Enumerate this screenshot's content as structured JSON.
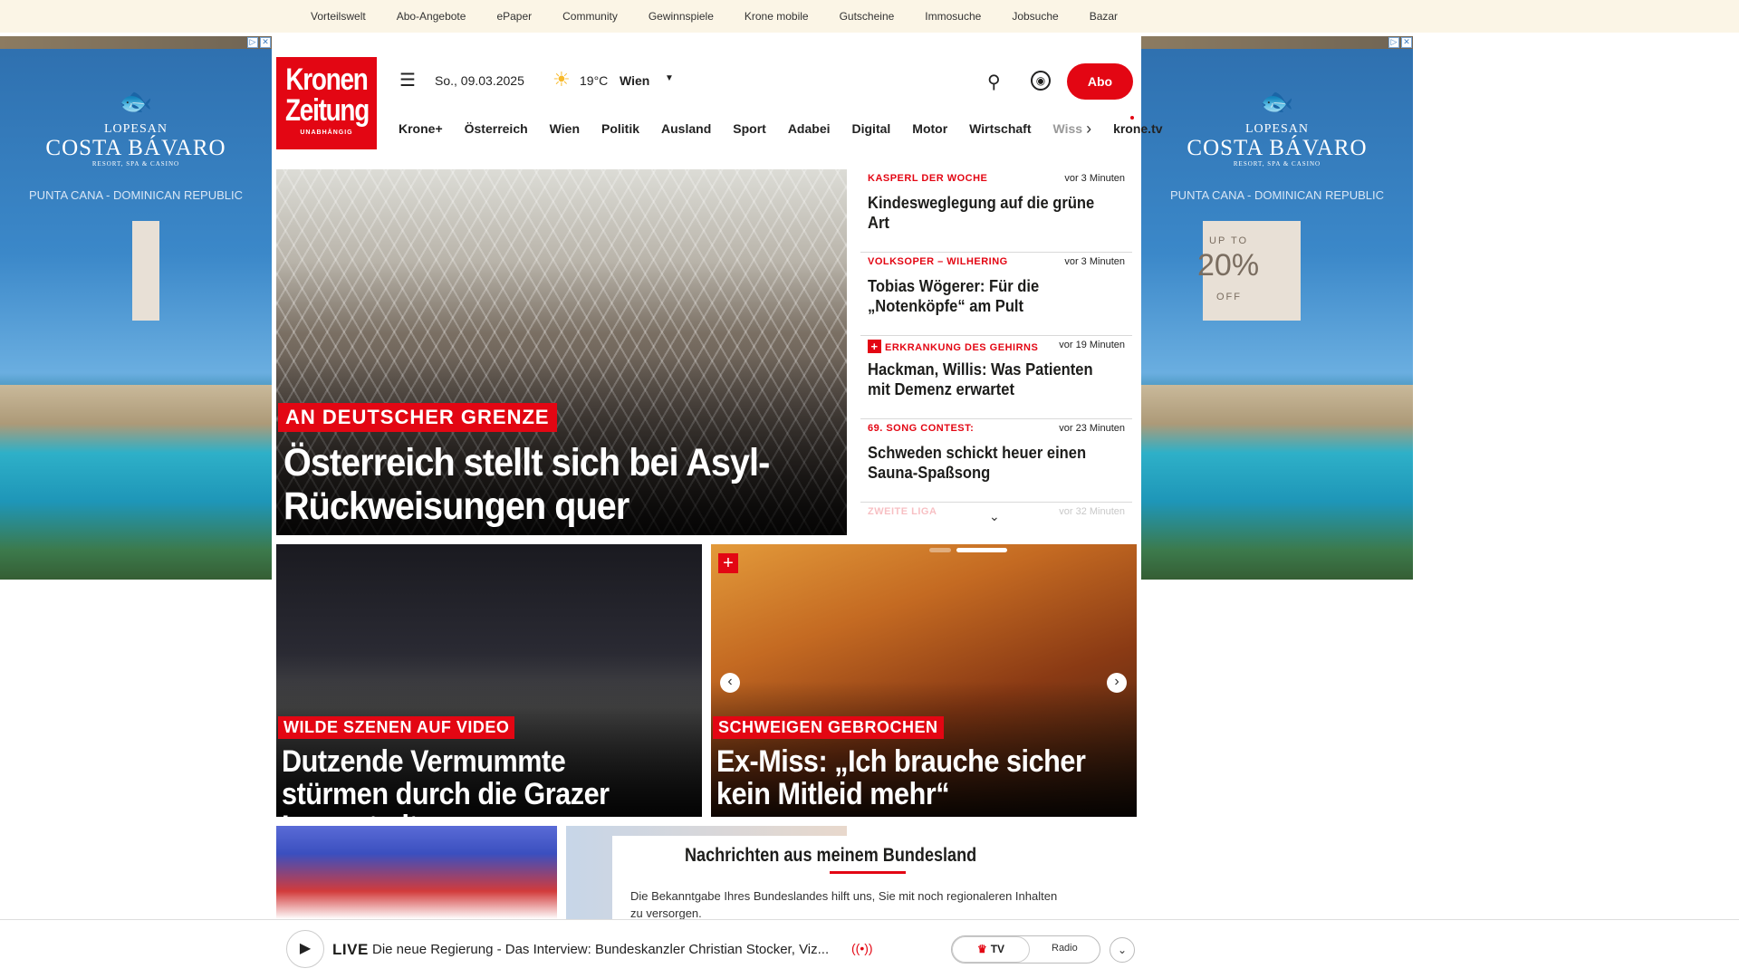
{
  "topbar": {
    "links": [
      "Vorteilswelt",
      "Abo-Angebote",
      "ePaper",
      "Community",
      "Gewinnspiele",
      "Krone mobile",
      "Gutscheine",
      "Immosuche",
      "Jobsuche",
      "Bazar"
    ]
  },
  "ads": {
    "brand_small": "LOPESAN",
    "brand_big": "COSTA BÁVARO",
    "brand_sub": "RESORT, SPA & CASINO",
    "location": "PUNTA CANA - DOMINICAN REPUBLIC",
    "promo_upto": "UP TO",
    "promo_pct": "20%",
    "promo_off": "OFF",
    "close_icons": [
      "ad-info-icon",
      "close-icon"
    ]
  },
  "logo": {
    "line1": "Kronen",
    "line2": "Zeitung",
    "line3": "UNABHÄNGIG"
  },
  "header": {
    "date": "So., 09.03.2025",
    "temperature": "19°C",
    "city": "Wien",
    "abo_label": "Abo",
    "icons": [
      "menu-icon",
      "sun-icon",
      "chevron-down-icon",
      "search-icon",
      "user-icon"
    ]
  },
  "nav": {
    "items": [
      "Krone+",
      "Österreich",
      "Wien",
      "Politik",
      "Ausland",
      "Sport",
      "Adabei",
      "Digital",
      "Motor",
      "Wirtschaft"
    ],
    "truncated": "Wiss",
    "extra": "krone.tv"
  },
  "hero": {
    "kicker": "AN DEUTSCHER GRENZE",
    "title": "Österreich stellt sich bei Asyl-Rückweisungen quer"
  },
  "sidebar": {
    "items": [
      {
        "kicker": "KASPERL DER WOCHE",
        "time": "vor 3 Minuten",
        "headline": "Kindesweglegung auf die grüne Art",
        "plus": false
      },
      {
        "kicker": "VOLKSOPER – WILHERING",
        "time": "vor 3 Minuten",
        "headline": "Tobias Wögerer: Für die „Notenköpfe“ am Pult",
        "plus": false
      },
      {
        "kicker": "ERKRANKUNG DES GEHIRNS",
        "time": "vor 19 Minuten",
        "headline": "Hackman, Willis: Was Patienten mit Demenz erwartet",
        "plus": true
      },
      {
        "kicker": "69. SONG CONTEST:",
        "time": "vor 23 Minuten",
        "headline": "Schweden schickt heuer einen Sauna-Spaßsong",
        "plus": false
      },
      {
        "kicker": "ZWEITE LIGA",
        "time": "vor 32 Minuten",
        "headline": "",
        "plus": false
      }
    ]
  },
  "tiles": [
    {
      "kicker": "WILDE SZENEN AUF VIDEO",
      "title": "Dutzende Vermummte stürmen durch die Grazer Innenstadt"
    },
    {
      "kicker": "SCHWEIGEN GEBROCHEN",
      "title": "Ex-Miss: „Ich brauche sicher kein Mitleid mehr“"
    }
  ],
  "bundesland": {
    "heading": "Nachrichten aus meinem Bundesland",
    "text": "Die Bekanntgabe Ihres Bundeslandes hilft uns, Sie mit noch regionaleren Inhalten zu versorgen."
  },
  "player": {
    "live": "LIVE",
    "text": "Die neue Regierung - Das Interview: Bundeskanzler Christian Stocker, Viz...",
    "tv": "TV",
    "radio": "Radio"
  },
  "colors": {
    "accent": "#e30613",
    "topbar_bg": "#fbf5e6"
  }
}
